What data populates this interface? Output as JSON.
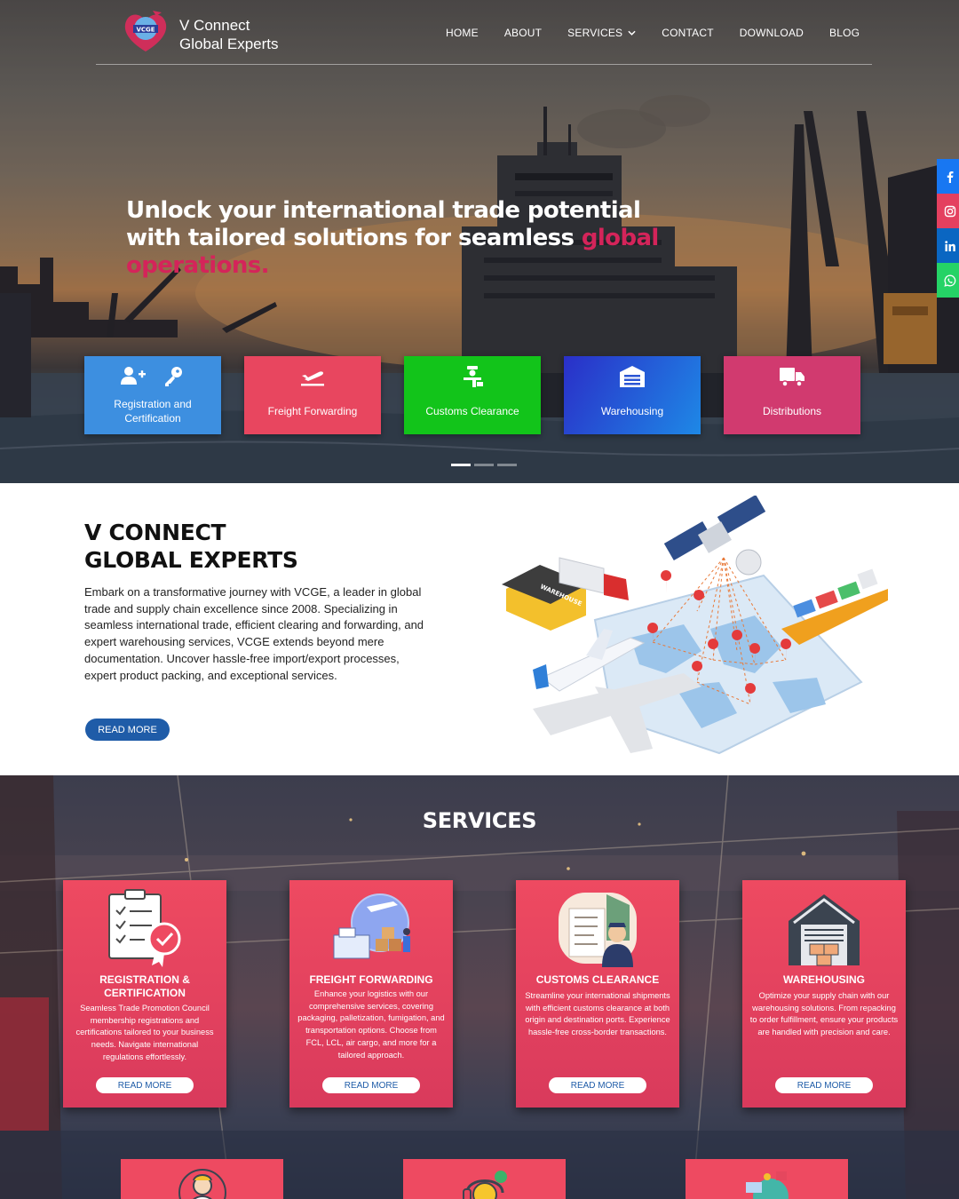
{
  "brand": {
    "line1": "V Connect",
    "line2": "Global Experts",
    "logo_text": "VCGE",
    "logo_tagline": "Globalizing Your Growth"
  },
  "nav": {
    "items": [
      {
        "label": "HOME"
      },
      {
        "label": "ABOUT"
      },
      {
        "label": "SERVICES",
        "has_dropdown": true
      },
      {
        "label": "CONTACT"
      },
      {
        "label": "DOWNLOAD"
      },
      {
        "label": "BLOG"
      }
    ]
  },
  "hero": {
    "heading_main": "Unlock your international trade potential with tailored solutions for seamless ",
    "heading_accent": "global operations.",
    "slides_count": 3,
    "active_slide": 1
  },
  "hero_tiles": [
    {
      "label": "Registration and Certification",
      "icon": "user-plus-key-icon",
      "color": "#3d8fe0"
    },
    {
      "label": "Freight Forwarding",
      "icon": "plane-departure-icon",
      "color": "#e8465f"
    },
    {
      "label": "Customs Clearance",
      "icon": "customs-officer-icon",
      "color": "#12c41a"
    },
    {
      "label": "Warehousing",
      "icon": "warehouse-icon",
      "color": "#2a5ad8"
    },
    {
      "label": "Distributions",
      "icon": "truck-icon",
      "color": "#d13a6f"
    }
  ],
  "social": [
    {
      "name": "facebook",
      "glyph": "f",
      "color": "#1877f2"
    },
    {
      "name": "instagram",
      "glyph": "instagram",
      "color": "#e4405f"
    },
    {
      "name": "linkedin",
      "glyph": "in",
      "color": "#0a66c2"
    },
    {
      "name": "whatsapp",
      "glyph": "whatsapp",
      "color": "#25d366"
    }
  ],
  "about": {
    "title_line1": "V CONNECT",
    "title_line2": "GLOBAL EXPERTS",
    "text": "Embark on a transformative journey with VCGE, a leader in global trade and supply chain excellence since 2008. Specializing in seamless international trade, efficient clearing and forwarding, and expert warehousing services, VCGE extends beyond mere documentation. Uncover hassle-free import/export processes, expert product packing, and exceptional services.",
    "button": "READ MORE",
    "illustration_label": "WAREHOUSE"
  },
  "services": {
    "title": "SERVICES",
    "cards": [
      {
        "title": "REGISTRATION & CERTIFICATION",
        "text": "Seamless Trade Promotion Council membership registrations and certifications tailored to your business needs. Navigate international regulations effortlessly.",
        "button": "READ MORE",
        "icon": "certificate-clipboard-icon"
      },
      {
        "title": "FREIGHT FORWARDING",
        "text": "Enhance your logistics with our comprehensive services, covering packaging, palletization, fumigation, and transportation options. Choose from FCL, LCL, air cargo, and more for a tailored approach.",
        "button": "READ MORE",
        "icon": "freight-globe-icon"
      },
      {
        "title": "CUSTOMS CLEARANCE",
        "text": "Streamline your international shipments with efficient customs clearance at both origin and destination ports. Experience hassle-free cross-border transactions.",
        "button": "READ MORE",
        "icon": "customs-documents-icon"
      },
      {
        "title": "WAREHOUSING",
        "text": "Optimize your supply chain with our warehousing solutions. From repacking to order fulfillment, ensure your products are handled with precision and care.",
        "button": "READ MORE",
        "icon": "warehouse-building-icon"
      }
    ],
    "more_cards": [
      {
        "icon": "agent-network-icon"
      },
      {
        "icon": "support-headset-icon"
      },
      {
        "icon": "distribution-globe-icon"
      }
    ]
  }
}
